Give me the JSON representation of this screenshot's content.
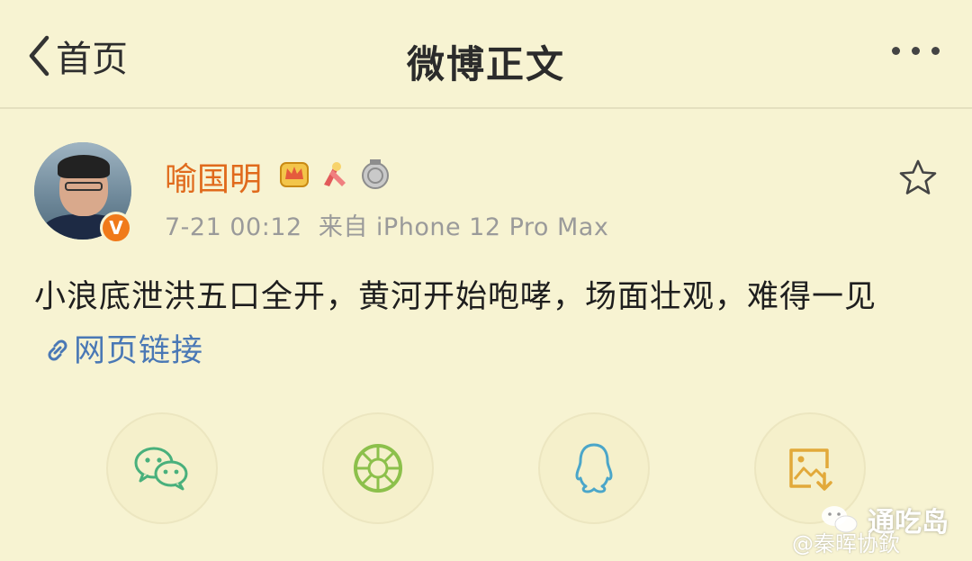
{
  "nav": {
    "back_label": "首页",
    "title": "微博正文",
    "back_icon": "chevron-left-icon",
    "more_icon": "more-dots-icon"
  },
  "post": {
    "author": "喻国明",
    "verified_badge": "V",
    "time": "7-21 00:12",
    "source": "来自 iPhone 12 Pro Max",
    "text": "小浪底泄洪五口全开，黄河开始咆哮，场面壮观，难得一见",
    "link_label": "网页链接",
    "colors": {
      "author": "#e06a1c",
      "link": "#4a78b5",
      "background": "#f7f3d2"
    }
  },
  "share": {
    "icons": [
      "wechat-icon",
      "moments-icon",
      "qq-icon",
      "save-image-icon"
    ]
  },
  "watermark": {
    "primary": "通吃岛",
    "secondary": "@秦晖协欽"
  }
}
